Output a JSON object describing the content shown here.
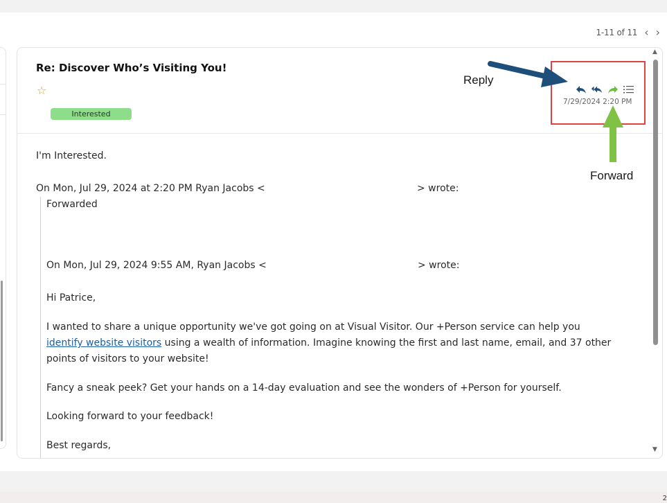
{
  "pager": {
    "count": "1-11 of 11"
  },
  "email": {
    "subject": "Re: Discover Who’s Visiting You!",
    "tag": "Interested",
    "timestamp": "7/29/2024 2:20 PM",
    "body": {
      "first_line": "I'm Interested.",
      "wrote_prefix": "On Mon, Jul 29, 2024 at 2:20 PM Ryan Jacobs <",
      "wrote_suffix": "> wrote:",
      "forwarded": "Forwarded",
      "quoted_prefix": "On Mon, Jul 29, 2024 9:55 AM, Ryan Jacobs <",
      "quoted_suffix": "> wrote:",
      "greeting": "Hi Patrice,",
      "para1_start": "I wanted to share a unique opportunity we've got going on at Visual Visitor. Our +Person service can help you",
      "para1_link": "identify website visitors",
      "para1_rest": " using a wealth of information. Imagine knowing the first and last name, email, and 37 other",
      "para1_end": "points of visitors to your website!",
      "para2": "Fancy a sneak peek? Get your hands on a 14-day evaluation and see the wonders of +Person for yourself.",
      "para3": "Looking forward to your feedback!",
      "signoff": "Best regards,"
    }
  },
  "annotations": {
    "reply_label": "Reply",
    "forward_label": "Forward"
  },
  "footer": {
    "corner": "2"
  },
  "colors": {
    "accent_reply": "#1d4f7a",
    "accent_forward": "#6cbf3c",
    "callout_box": "#e04141",
    "tag_bg": "#8ddd8a"
  },
  "icons": [
    "star-icon",
    "reply-icon",
    "reply-all-icon",
    "forward-icon",
    "list-icon",
    "chevron-left-icon",
    "chevron-right-icon"
  ]
}
